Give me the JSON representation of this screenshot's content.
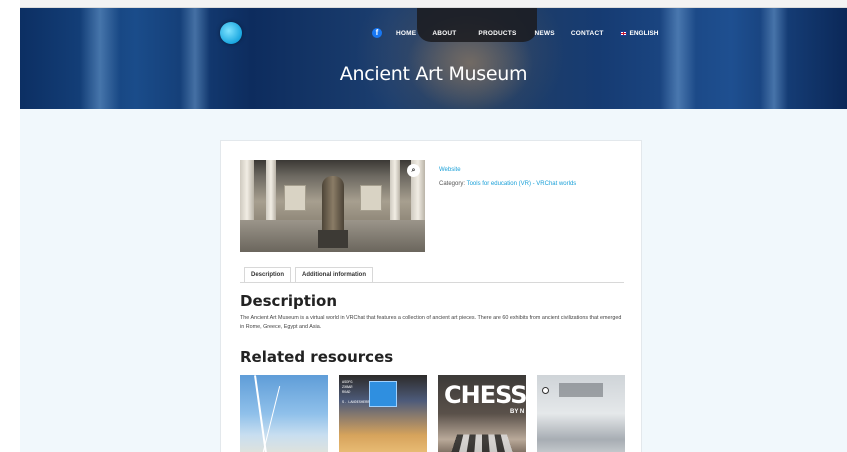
{
  "nav": {
    "items": [
      "HOME",
      "ABOUT",
      "PRODUCTS",
      "NEWS",
      "CONTACT"
    ],
    "language": "ENGLISH",
    "facebook_glyph": "f"
  },
  "logo": {
    "text": ""
  },
  "hero": {
    "title": "Ancient Art Museum"
  },
  "product": {
    "zoom_glyph": "⌕",
    "website_link": "Website",
    "category_label": "Category:",
    "category_value": "Tools for education (VR) - VRChat worlds"
  },
  "tabs": [
    "Description",
    "Additional information"
  ],
  "description": {
    "heading": "Description",
    "text": "The Ancient Art Museum is a virtual world in VRChat that features a collection of ancient art pieces. There are 60 exhibits from ancient civilizations that emerged in Rome, Greece, Egypt and Asia."
  },
  "related": {
    "heading": "Related resources",
    "thumb2_text": "ASDFG\nZXBAR\nROAD\n\nS. LANDESHERR",
    "thumb3_title": "CHESS",
    "thumb3_by": "BY N"
  },
  "colors": {
    "accent": "#1aa0d8",
    "hero_bg": "#0d2c5e",
    "page_bg": "#f1f8fc"
  }
}
